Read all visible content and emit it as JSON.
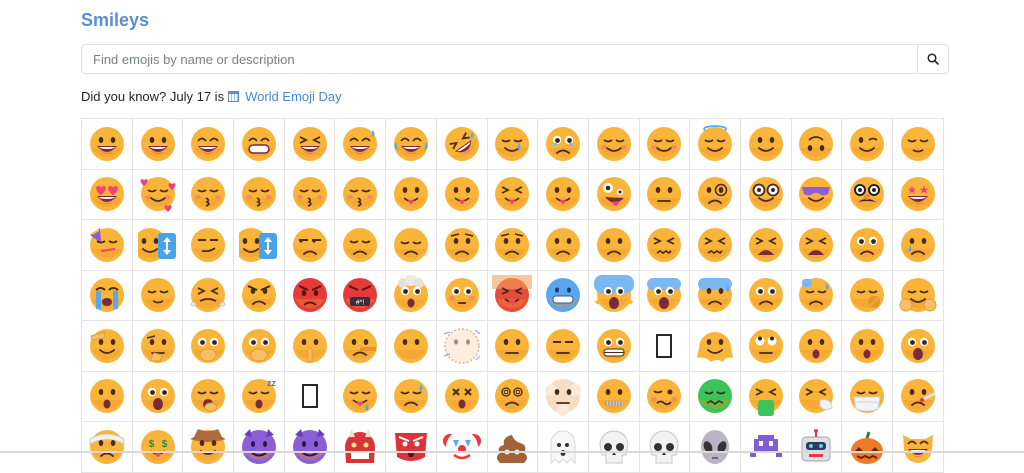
{
  "page": {
    "title": "Smileys"
  },
  "search": {
    "placeholder": "Find emojis by name or description",
    "button_icon": "search-icon"
  },
  "did_you_know": {
    "prefix": "Did you know? July 17 is",
    "icon": "calendar-icon",
    "link_text": "World Emoji Day"
  },
  "colors": {
    "accent": "#5b8fd1",
    "link": "#4a86cf",
    "face": "#f9b43a",
    "face_edge": "#e8942a",
    "mouth": "#7a2a3a",
    "heart": "#f0417a",
    "purple": "#8a5fd6",
    "blue": "#4aa3e8",
    "green": "#3cc35a"
  },
  "emojis": [
    {
      "name": "grinning-face",
      "v": "grin"
    },
    {
      "name": "grinning-face-big-eyes",
      "v": "grin"
    },
    {
      "name": "grinning-face-smiling-eyes",
      "v": "grinsq"
    },
    {
      "name": "beaming-face",
      "v": "teeth"
    },
    {
      "name": "grinning-squinting-face",
      "v": "xgrin"
    },
    {
      "name": "grinning-face-sweat",
      "v": "sweat"
    },
    {
      "name": "face-with-tears-of-joy",
      "v": "joy"
    },
    {
      "name": "rolling-on-floor-laughing",
      "v": "rofl"
    },
    {
      "name": "smiling-face-with-tear",
      "v": "tear"
    },
    {
      "name": "face-holding-back-tears",
      "v": "holdtear"
    },
    {
      "name": "smiling-face-smiling-eyes",
      "v": "blush"
    },
    {
      "name": "smiling-face",
      "v": "blush"
    },
    {
      "name": "smiling-face-with-halo",
      "v": "halo"
    },
    {
      "name": "slightly-smiling-face",
      "v": "slight"
    },
    {
      "name": "upside-down-face",
      "v": "upside"
    },
    {
      "name": "winking-face",
      "v": "wink"
    },
    {
      "name": "relieved-face",
      "v": "relieved"
    },
    {
      "name": "smiling-face-heart-eyes",
      "v": "hearteyes"
    },
    {
      "name": "smiling-face-with-hearts",
      "v": "hearts"
    },
    {
      "name": "face-blowing-kiss",
      "v": "kiss"
    },
    {
      "name": "kissing-face",
      "v": "kiss"
    },
    {
      "name": "kissing-face-smiling-eyes",
      "v": "kiss"
    },
    {
      "name": "kissing-face-closed-eyes",
      "v": "kiss"
    },
    {
      "name": "face-savoring-food",
      "v": "tongue"
    },
    {
      "name": "face-with-tongue",
      "v": "tongue"
    },
    {
      "name": "squinting-face-tongue",
      "v": "xtongue"
    },
    {
      "name": "winking-face-tongue",
      "v": "tongue"
    },
    {
      "name": "zany-face",
      "v": "zany"
    },
    {
      "name": "face-with-raised-eyebrow",
      "v": "neutral"
    },
    {
      "name": "face-with-monocle",
      "v": "monocle"
    },
    {
      "name": "nerd-face",
      "v": "nerd"
    },
    {
      "name": "smiling-face-sunglasses",
      "v": "cool"
    },
    {
      "name": "disguised-face",
      "v": "disguise"
    },
    {
      "name": "star-struck",
      "v": "star"
    },
    {
      "name": "partying-face",
      "v": "party"
    },
    {
      "name": "rotated-face-a",
      "v": "rotate"
    },
    {
      "name": "smirking-face",
      "v": "smirk"
    },
    {
      "name": "rotated-face-b",
      "v": "rotate"
    },
    {
      "name": "unamused-face",
      "v": "unamused"
    },
    {
      "name": "disappointed-face",
      "v": "sad"
    },
    {
      "name": "pensive-face",
      "v": "pensive"
    },
    {
      "name": "worried-face",
      "v": "worried"
    },
    {
      "name": "confused-face",
      "v": "worried"
    },
    {
      "name": "slightly-frowning-face",
      "v": "frown"
    },
    {
      "name": "frowning-face",
      "v": "frown"
    },
    {
      "name": "persevering-face",
      "v": "xfrown"
    },
    {
      "name": "confounded-face",
      "v": "xfrown"
    },
    {
      "name": "tired-face",
      "v": "tired"
    },
    {
      "name": "weary-face",
      "v": "tired"
    },
    {
      "name": "pleading-face",
      "v": "plead"
    },
    {
      "name": "face-with-tear",
      "v": "cry"
    },
    {
      "name": "loudly-crying-face",
      "v": "sob"
    },
    {
      "name": "face-with-steam",
      "v": "relieved"
    },
    {
      "name": "face-with-steam-nose",
      "v": "steam"
    },
    {
      "name": "angry-face",
      "v": "angry"
    },
    {
      "name": "enraged-face",
      "v": "redangry"
    },
    {
      "name": "face-with-symbols",
      "v": "symbols"
    },
    {
      "name": "exploding-head",
      "v": "explode"
    },
    {
      "name": "flushed-face",
      "v": "flushed"
    },
    {
      "name": "hot-face",
      "v": "hot"
    },
    {
      "name": "cold-face",
      "v": "cold"
    },
    {
      "name": "face-screaming",
      "v": "scream"
    },
    {
      "name": "fearful-face",
      "v": "fear"
    },
    {
      "name": "anxious-face-sweat",
      "v": "anxious"
    },
    {
      "name": "sad-relieved-face",
      "v": "plead"
    },
    {
      "name": "downcast-face-sweat",
      "v": "downcast"
    },
    {
      "name": "hugging-face-yawn",
      "v": "yawn"
    },
    {
      "name": "hugging-face",
      "v": "hug"
    },
    {
      "name": "face-with-hand-over-mouth",
      "v": "saluting"
    },
    {
      "name": "thinking-face",
      "v": "think"
    },
    {
      "name": "face-open-eyes-hand",
      "v": "handmouth"
    },
    {
      "name": "face-with-open-hand",
      "v": "handmouth"
    },
    {
      "name": "shushing-face",
      "v": "shush"
    },
    {
      "name": "lying-face",
      "v": "lying"
    },
    {
      "name": "face-without-mouth",
      "v": "blank"
    },
    {
      "name": "dotted-line-face",
      "v": "dotted"
    },
    {
      "name": "neutral-face",
      "v": "neutral"
    },
    {
      "name": "expressionless-face",
      "v": "expressionless"
    },
    {
      "name": "grimacing-face",
      "v": "grimace"
    },
    {
      "name": "missing-glyph-a",
      "v": "box"
    },
    {
      "name": "melting-face",
      "v": "melting"
    },
    {
      "name": "face-rolling-eyes",
      "v": "rolleyes"
    },
    {
      "name": "hushed-face",
      "v": "hushed"
    },
    {
      "name": "anguished-face",
      "v": "hushed"
    },
    {
      "name": "astonished-face",
      "v": "astonish"
    },
    {
      "name": "face-open-mouth",
      "v": "hushed"
    },
    {
      "name": "astonished-face-2",
      "v": "astonish"
    },
    {
      "name": "yawning-face",
      "v": "yawning"
    },
    {
      "name": "sleeping-face",
      "v": "sleep"
    },
    {
      "name": "missing-glyph-b",
      "v": "box"
    },
    {
      "name": "drooling-face",
      "v": "drool"
    },
    {
      "name": "sleepy-face",
      "v": "sleepy"
    },
    {
      "name": "face-crossed-out-eyes",
      "v": "xeyes"
    },
    {
      "name": "face-spiral-eyes",
      "v": "spiral"
    },
    {
      "name": "face-in-clouds",
      "v": "cloud"
    },
    {
      "name": "zipper-mouth",
      "v": "zipper"
    },
    {
      "name": "woozy-face",
      "v": "woozy"
    },
    {
      "name": "nauseated-face",
      "v": "nausea"
    },
    {
      "name": "vomiting-face",
      "v": "vomit"
    },
    {
      "name": "sneezing-face",
      "v": "sneeze"
    },
    {
      "name": "face-medical-mask",
      "v": "mask"
    },
    {
      "name": "face-thermometer",
      "v": "thermo"
    },
    {
      "name": "face-head-bandage",
      "v": "bandage"
    },
    {
      "name": "money-mouth-face",
      "v": "money"
    },
    {
      "name": "cowboy-hat-face",
      "v": "cowboy"
    },
    {
      "name": "smiling-face-horns",
      "v": "devil"
    },
    {
      "name": "angry-face-horns",
      "v": "devil"
    },
    {
      "name": "ogre",
      "v": "ogre"
    },
    {
      "name": "goblin",
      "v": "goblin"
    },
    {
      "name": "clown-face",
      "v": "clown"
    },
    {
      "name": "pile-of-poo",
      "v": "poo"
    },
    {
      "name": "ghost",
      "v": "ghost"
    },
    {
      "name": "skull",
      "v": "skull"
    },
    {
      "name": "skull-crossbones",
      "v": "skull"
    },
    {
      "name": "alien",
      "v": "alien"
    },
    {
      "name": "alien-monster",
      "v": "invader"
    },
    {
      "name": "robot",
      "v": "robot"
    },
    {
      "name": "jack-o-lantern",
      "v": "pumpkin"
    },
    {
      "name": "grinning-cat",
      "v": "cat"
    }
  ]
}
